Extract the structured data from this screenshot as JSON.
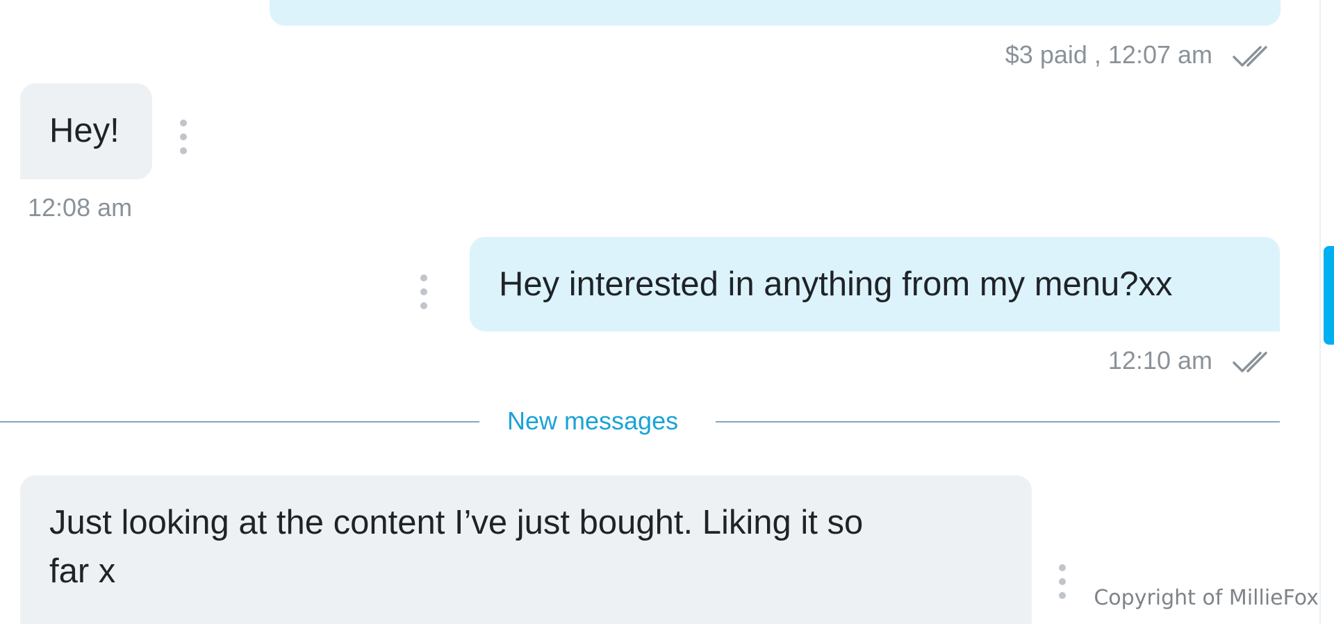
{
  "messages": [
    {
      "direction": "outgoing",
      "text": "",
      "meta": "$3 paid , 12:07 am",
      "read": true
    },
    {
      "direction": "incoming",
      "text": "Hey!",
      "meta": "12:08 am"
    },
    {
      "direction": "outgoing",
      "text": "Hey interested in anything from my menu?xx",
      "meta": "12:10 am",
      "read": true
    },
    {
      "direction": "incoming",
      "text_line1": "Just looking at the content I’ve just bought. Liking it so",
      "text_line2": "far x"
    }
  ],
  "divider": {
    "label": "New messages"
  },
  "watermark": "Copyright of MillieFox",
  "colors": {
    "outgoing_bubble": "#dcf3fb",
    "incoming_bubble": "#eef1f3",
    "accent": "#00aff0",
    "divider_text": "#1aa3d6",
    "meta_text": "#8a9299"
  },
  "icons": {
    "read_receipt": "double-check-icon",
    "message_options": "vertical-dots-icon"
  }
}
